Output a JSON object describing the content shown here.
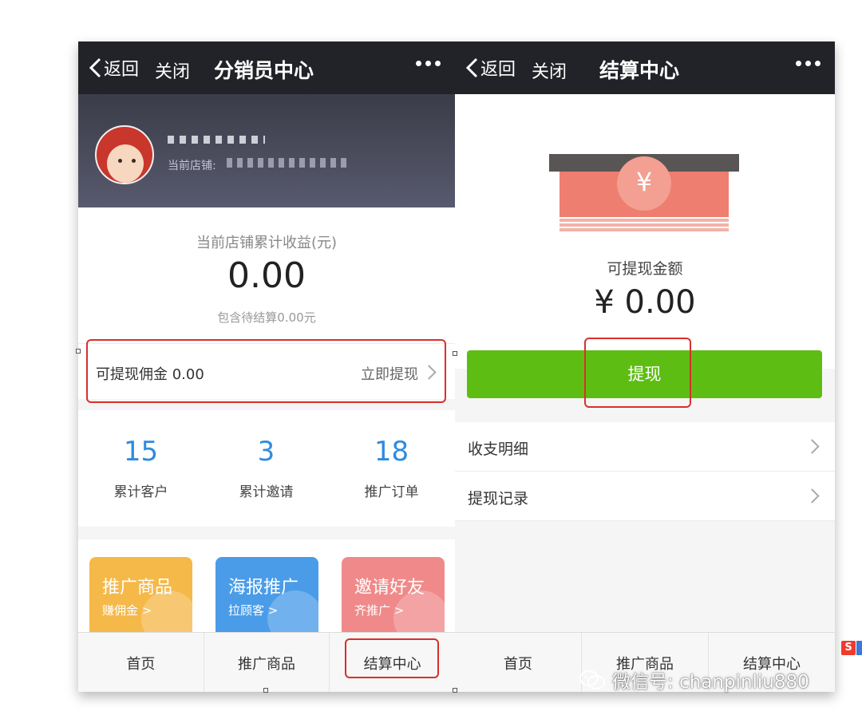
{
  "left_screen": {
    "nav": {
      "back_label": "返回",
      "close_label": "关闭",
      "title": "分销员中心"
    },
    "profile": {
      "shop_label": "当前店铺:"
    },
    "earnings": {
      "title": "当前店铺累计收益(元)",
      "value": "0.00",
      "sub": "包含待结算0.00元"
    },
    "commission": {
      "label": "可提现佣金 0.00",
      "action": "立即提现"
    },
    "stats": [
      {
        "value": "15",
        "label": "累计客户"
      },
      {
        "value": "3",
        "label": "累计邀请"
      },
      {
        "value": "18",
        "label": "推广订单"
      }
    ],
    "tiles": [
      {
        "title": "推广商品",
        "sub": "赚佣金 >",
        "color": "#f5b94a"
      },
      {
        "title": "海报推广",
        "sub": "拉顾客 >",
        "color": "#4a9ce8"
      },
      {
        "title": "邀请好友",
        "sub": "齐推广 >",
        "color": "#f08a8a"
      }
    ],
    "tabs": [
      "首页",
      "推广商品",
      "结算中心"
    ]
  },
  "right_screen": {
    "nav": {
      "back_label": "返回",
      "close_label": "关闭",
      "title": "结算中心"
    },
    "bill_symbol": "¥",
    "withdraw": {
      "label": "可提现金额",
      "amount": "¥ 0.00",
      "button": "提现"
    },
    "list": [
      {
        "label": "收支明细"
      },
      {
        "label": "提现记录"
      }
    ],
    "tabs": [
      "首页",
      "推广商品",
      "结算中心"
    ]
  },
  "watermark": {
    "text": "微信号: chanpinliu880"
  },
  "colors": {
    "nav_bg": "#222328",
    "accent_blue": "#2f8be0",
    "button_green": "#5ebd13",
    "highlight_red": "#d8302a"
  }
}
